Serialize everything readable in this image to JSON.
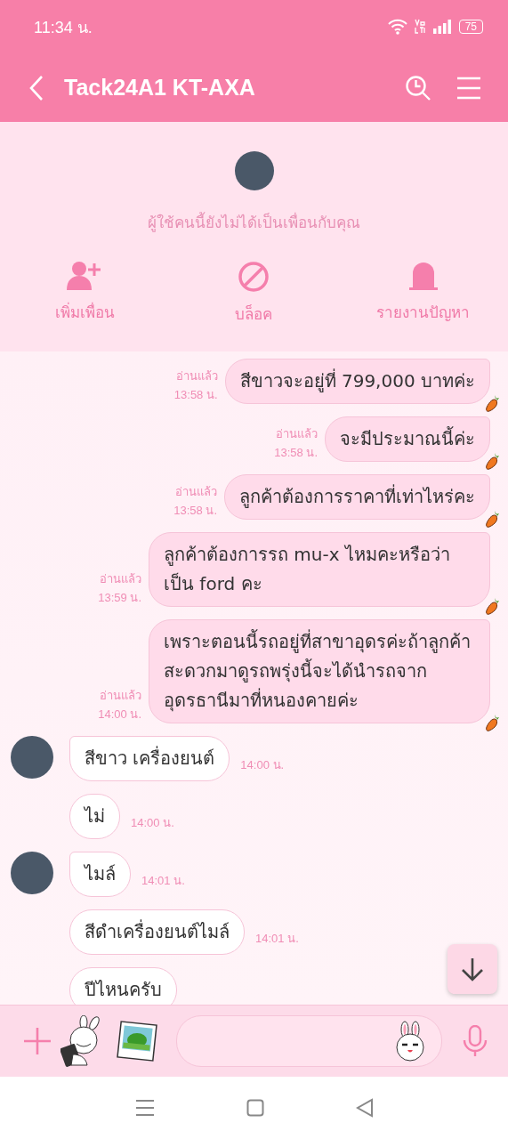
{
  "status_bar": {
    "time": "11:34 น.",
    "battery": "75"
  },
  "header": {
    "title": "Tack24A1 KT-AXA"
  },
  "profile": {
    "notice": "ผู้ใช้คนนี้ยังไม่ได้เป็นเพื่อนกับคุณ",
    "actions": [
      {
        "kind": "add",
        "label": "เพิ่มเพื่อน"
      },
      {
        "kind": "block",
        "label": "บล็อค"
      },
      {
        "kind": "report",
        "label": "รายงานปัญหา"
      }
    ]
  },
  "messages": [
    {
      "kind": "outgoing",
      "text": "สีขาวจะอยู่ที่ 799,000 บาทค่ะ",
      "read": "อ่านแล้ว",
      "time": "13:58 น."
    },
    {
      "kind": "outgoing",
      "text": "จะมีประมาณนี้ค่ะ",
      "read": "อ่านแล้ว",
      "time": "13:58 น."
    },
    {
      "kind": "outgoing",
      "text": "ลูกค้าต้องการราคาที่เท่าไหร่คะ",
      "read": "อ่านแล้ว",
      "time": "13:58 น."
    },
    {
      "kind": "outgoing",
      "text": "ลูกค้าต้องการรถ mu-x ไหมคะหรือว่าเป็น ford คะ",
      "read": "อ่านแล้ว",
      "time": "13:59 น."
    },
    {
      "kind": "outgoing",
      "text": "เพราะตอนนี้รถอยู่ที่สาขาอุดรค่ะถ้าลูกค้าสะดวกมาดูรถพรุ่งนี้จะได้นำรถจากอุดรธานีมาที่หนองคายค่ะ",
      "read": "อ่านแล้ว",
      "time": "14:00 น."
    },
    {
      "kind": "incoming",
      "avatar": true,
      "text": "สีขาว เครื่องยนต์",
      "time": "14:00 น."
    },
    {
      "kind": "incoming",
      "avatar": false,
      "text": "ไม่",
      "time": "14:00 น."
    },
    {
      "kind": "incoming",
      "avatar": true,
      "text": "ไมล์",
      "time": "14:01 น."
    },
    {
      "kind": "incoming",
      "avatar": false,
      "text": "สีดำเครื่องยนต์ไมล์",
      "time": "14:01 น."
    },
    {
      "kind": "incoming",
      "avatar": false,
      "text": "ปีไหนครับ"
    }
  ]
}
